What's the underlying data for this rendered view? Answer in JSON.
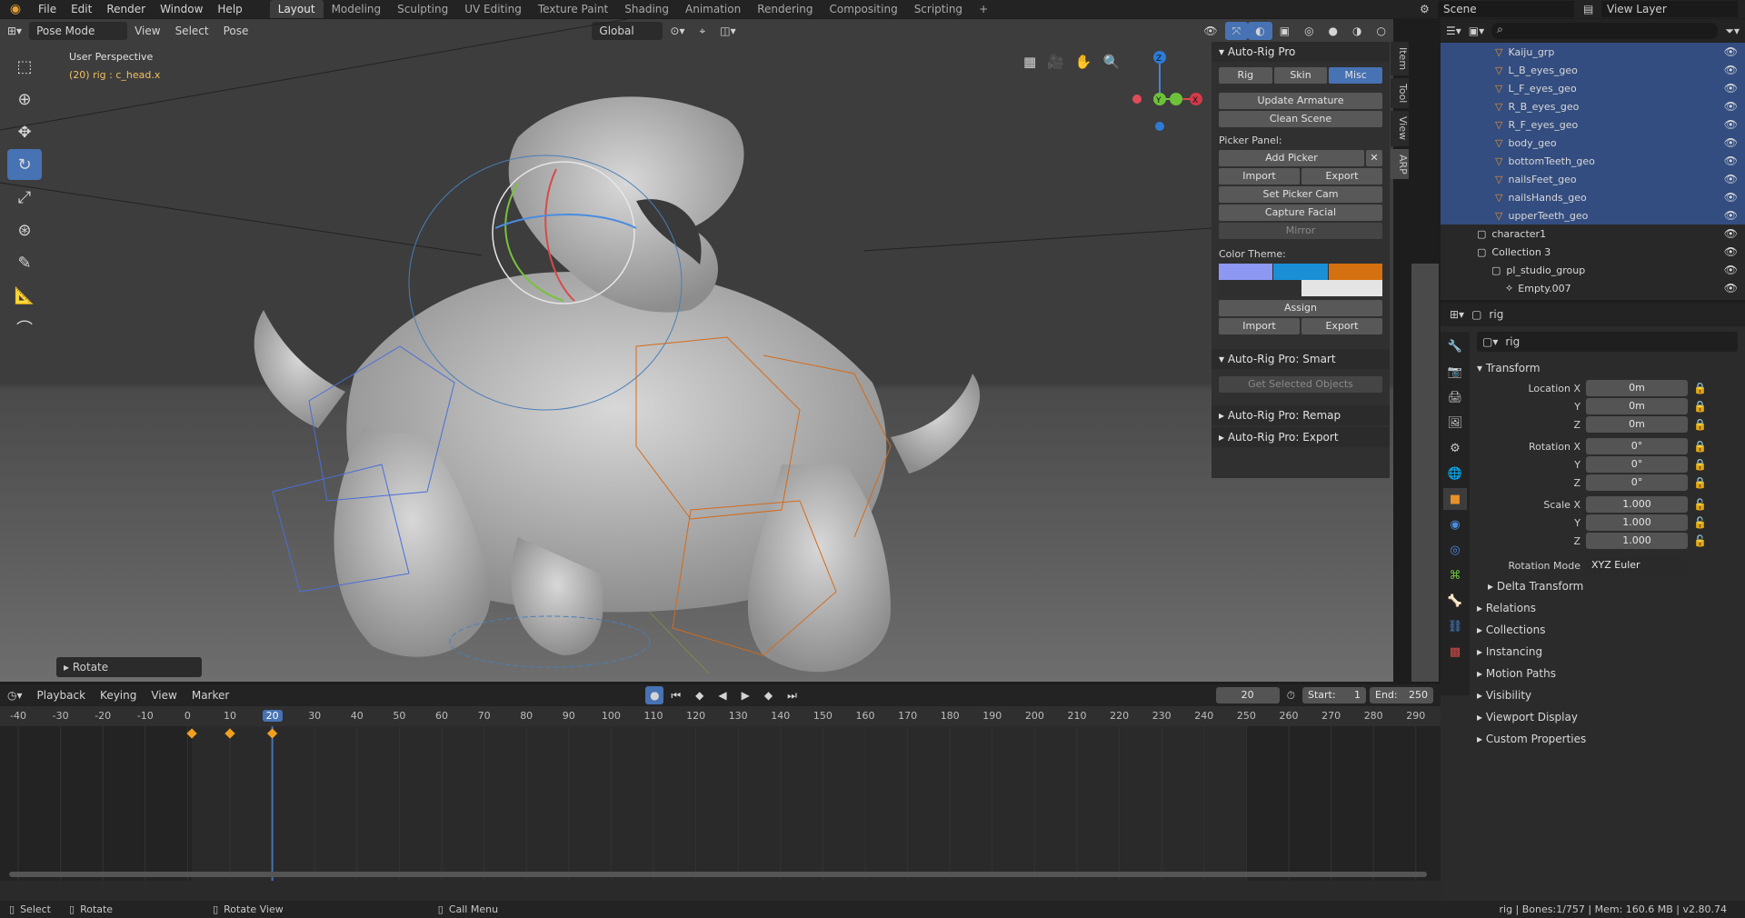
{
  "top_menu": {
    "items": [
      "File",
      "Edit",
      "Render",
      "Window",
      "Help"
    ],
    "workspaces": [
      "Layout",
      "Modeling",
      "Sculpting",
      "UV Editing",
      "Texture Paint",
      "Shading",
      "Animation",
      "Rendering",
      "Compositing",
      "Scripting"
    ],
    "active_workspace": "Layout",
    "add_label": "+",
    "scene_label": "Scene",
    "view_layer_label": "View Layer"
  },
  "viewport": {
    "mode": "Pose Mode",
    "menus": [
      "View",
      "Select",
      "Pose"
    ],
    "orientation": "Global",
    "overlay_title": "User Perspective",
    "overlay_sub": "(20) rig : c_head.x",
    "operator_panel": "Rotate",
    "gizmo": {
      "x": "X",
      "y": "Y",
      "z": "Z"
    }
  },
  "npanel": {
    "title": "Auto-Rig Pro",
    "tabs": [
      "Rig",
      "Skin",
      "Misc"
    ],
    "active_tab": "Misc",
    "update_btn": "Update Armature",
    "clean_btn": "Clean Scene",
    "picker_label": "Picker Panel:",
    "add_picker": "Add Picker",
    "import": "Import",
    "export": "Export",
    "set_cam": "Set Picker Cam",
    "capture": "Capture Facial",
    "mirror": "Mirror",
    "color_theme_label": "Color Theme:",
    "theme_colors": [
      "#8c98f2",
      "#1b8fd6",
      "#d4700f",
      "#2f2f2f",
      "#e4e4e4"
    ],
    "assign": "Assign",
    "smart_title": "Auto-Rig Pro: Smart",
    "get_selected": "Get Selected Objects",
    "remap_title": "Auto-Rig Pro: Remap",
    "export_title": "Auto-Rig Pro: Export",
    "side_tabs": [
      "Item",
      "Tool",
      "View",
      "ARP"
    ]
  },
  "outliner": {
    "rows": [
      {
        "label": "Kaiju_grp",
        "sel": true
      },
      {
        "label": "L_B_eyes_geo",
        "sel": true
      },
      {
        "label": "L_F_eyes_geo",
        "sel": true
      },
      {
        "label": "R_B_eyes_geo",
        "sel": true
      },
      {
        "label": "R_F_eyes_geo",
        "sel": true
      },
      {
        "label": "body_geo",
        "sel": true
      },
      {
        "label": "bottomTeeth_geo",
        "sel": true
      },
      {
        "label": "nailsFeet_geo",
        "sel": true
      },
      {
        "label": "nailsHands_geo",
        "sel": true
      },
      {
        "label": "upperTeeth_geo",
        "sel": true
      },
      {
        "label": "character1",
        "sel": false
      },
      {
        "label": "Collection 3",
        "sel": false
      },
      {
        "label": "pl_studio_group",
        "sel": false
      },
      {
        "label": "Empty.007",
        "sel": false
      }
    ]
  },
  "properties": {
    "object_name": "rig",
    "header_name": "rig",
    "transform_label": "Transform",
    "location_label": "Location X",
    "rotation_label": "Rotation X",
    "scale_label": "Scale X",
    "y": "Y",
    "z": "Z",
    "loc": [
      "0m",
      "0m",
      "0m"
    ],
    "rot": [
      "0°",
      "0°",
      "0°"
    ],
    "scale": [
      "1.000",
      "1.000",
      "1.000"
    ],
    "rotation_mode_label": "Rotation Mode",
    "rotation_mode": "XYZ Euler",
    "delta": "Delta Transform",
    "sections": [
      "Relations",
      "Collections",
      "Instancing",
      "Motion Paths",
      "Visibility",
      "Viewport Display",
      "Custom Properties"
    ]
  },
  "timeline": {
    "menus": [
      "Playback",
      "Keying",
      "View",
      "Marker"
    ],
    "current_frame": "20",
    "start_label": "Start:",
    "start": "1",
    "end_label": "End:",
    "end": "250",
    "ticks": [
      "-40",
      "-30",
      "-20",
      "-10",
      "0",
      "10",
      "20",
      "30",
      "40",
      "50",
      "60",
      "70",
      "80",
      "90",
      "100",
      "110",
      "120",
      "130",
      "140",
      "150",
      "160",
      "170",
      "180",
      "190",
      "200",
      "210",
      "220",
      "230",
      "240",
      "250",
      "260",
      "270",
      "280",
      "290"
    ],
    "keyframes": [
      1,
      10,
      20
    ]
  },
  "statusbar": {
    "select": "Select",
    "rotate": "Rotate",
    "rotate_view": "Rotate View",
    "call_menu": "Call Menu",
    "info": "rig | Bones:1/757 | Mem: 160.6 MB | v2.80.74"
  }
}
